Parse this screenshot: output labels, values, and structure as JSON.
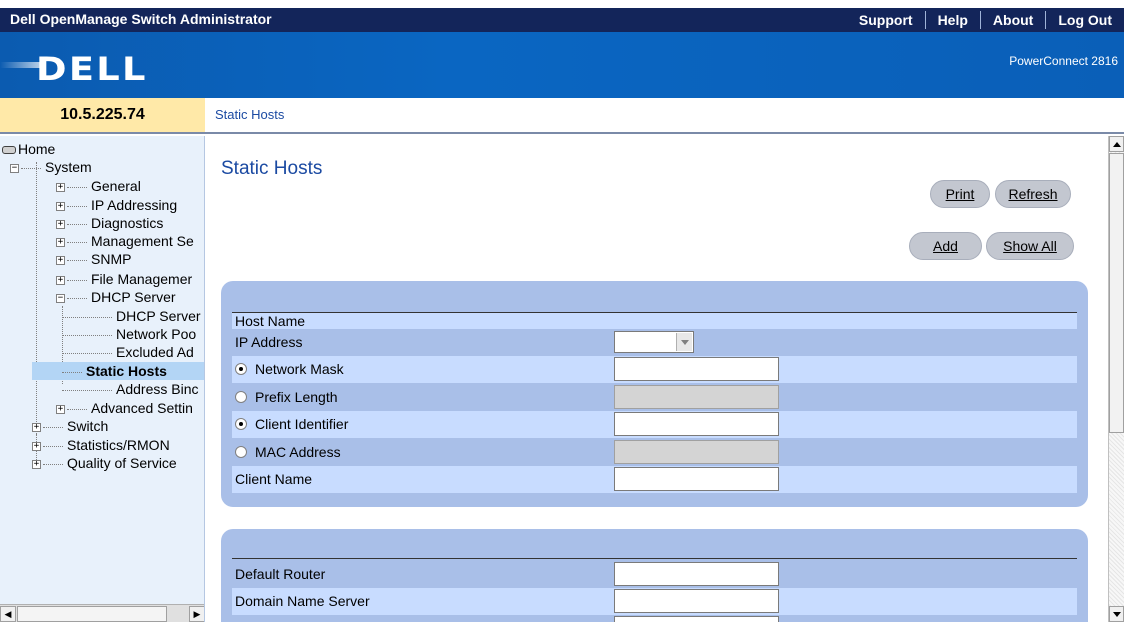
{
  "app_title": "Dell OpenManage Switch Administrator",
  "top_links": [
    "Support",
    "Help",
    "About",
    "Log Out"
  ],
  "brand": {
    "logo": "DELL",
    "model": "PowerConnect 2816"
  },
  "device_ip": "10.5.225.74",
  "breadcrumb": "Static Hosts",
  "tree": {
    "home": "Home",
    "system": "System",
    "general": "General",
    "ip_addressing": "IP Addressing",
    "diagnostics": "Diagnostics",
    "management_security": "Management Se",
    "snmp": "SNMP",
    "file_management": "File Managemer",
    "dhcp_server": "DHCP Server",
    "dhcp_server_child": "DHCP Server",
    "network_pool": "Network Poo",
    "excluded_addresses": "Excluded Ad",
    "static_hosts": "Static Hosts",
    "address_binding": "Address Binc",
    "advanced_settings": "Advanced Settin",
    "switch": "Switch",
    "statistics": "Statistics/RMON",
    "qos": "Quality of Service"
  },
  "page": {
    "title": "Static Hosts",
    "buttons": {
      "print": "Print",
      "refresh": "Refresh",
      "add": "Add",
      "show_all": "Show All"
    }
  },
  "form1": {
    "host_name": "Host Name",
    "ip_address": "IP Address",
    "ip_address_value": "",
    "network_mask": "Network Mask",
    "network_mask_value": "",
    "prefix_length": "Prefix Length",
    "prefix_length_value": "",
    "client_identifier": "Client Identifier",
    "client_identifier_value": "",
    "mac_address": "MAC Address",
    "mac_address_value": "",
    "client_name": "Client Name",
    "client_name_value": ""
  },
  "form2": {
    "default_router": "Default Router",
    "default_router_value": "",
    "domain_name_server": "Domain Name Server",
    "domain_name_server_value": ""
  },
  "colors": {
    "topbar": "#13255a",
    "brand": "#0a66c2",
    "ip_box": "#ffe9a8",
    "panel": "#a9bfe8",
    "title": "#1b4aa2"
  }
}
